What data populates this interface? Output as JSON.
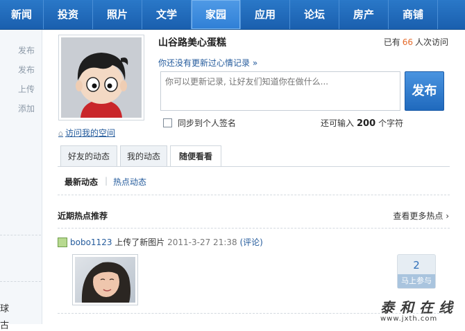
{
  "nav": {
    "items": [
      "新闻",
      "投资",
      "照片",
      "文学",
      "家园",
      "应用",
      "论坛",
      "房产",
      "商铺"
    ],
    "active_index": 4
  },
  "sidebar": {
    "items": [
      "发布",
      "发布",
      "上传",
      "添加"
    ],
    "bottom_items": [
      "球",
      "古"
    ]
  },
  "profile": {
    "user_name": "山谷路美心蛋糕",
    "visit_prefix": "已有",
    "visit_count": "66",
    "visit_suffix": "人次访问",
    "visit_space_link": "访问我的空间",
    "no_update_text": "你还没有更新过心情记录 »",
    "status_placeholder": "你可以更新记录, 让好友们知道你在做什么...",
    "publish_label": "发布",
    "sync_label": "同步到个人签名",
    "char_prefix": "还可输入",
    "char_count": "200",
    "char_suffix": "个字符"
  },
  "tabs": [
    "好友的动态",
    "我的动态",
    "随便看看"
  ],
  "active_tab": 2,
  "subtabs": [
    "最新动态",
    "热点动态"
  ],
  "hot": {
    "title": "近期热点推荐",
    "more_link": "查看更多热点 ›"
  },
  "feed": {
    "user": "bobo1123",
    "action": "上传了新图片",
    "timestamp": "2011-3-27 21:38",
    "comment_open": "(",
    "comment_link": "评论",
    "comment_close": ")",
    "join_count": "2",
    "join_label": "马上参与"
  },
  "watermark": {
    "cn": "泰和在线",
    "url": "www.jxth.com"
  },
  "colors": {
    "nav_blue": "#1f66b4",
    "link_blue": "#245b9c",
    "visit_orange": "#e46a2b"
  }
}
